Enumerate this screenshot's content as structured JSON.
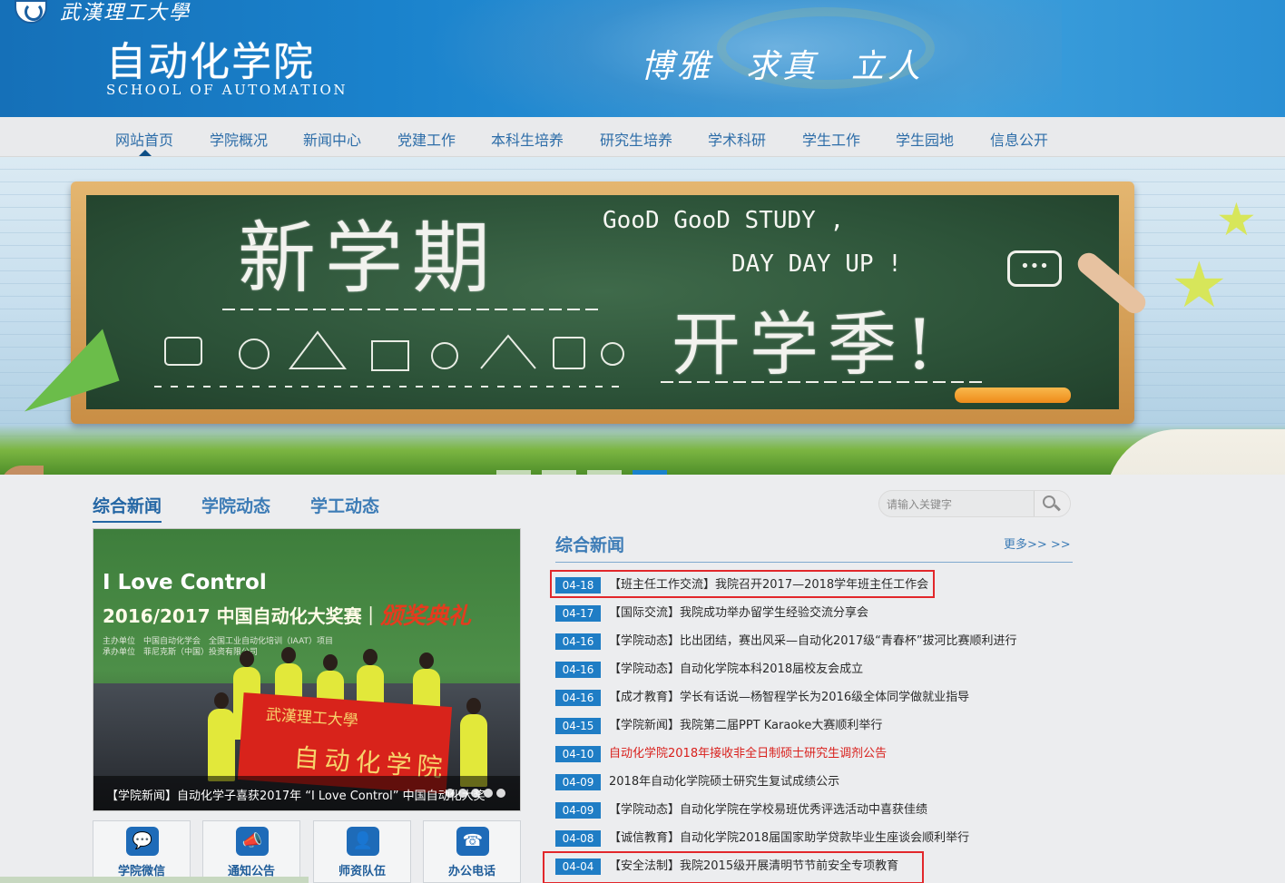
{
  "header": {
    "university": "武漢理工大學",
    "school_cn": "自动化学院",
    "school_en": "SCHOOL OF AUTOMATION",
    "motto": [
      "博雅",
      "求真",
      "立人"
    ]
  },
  "nav": {
    "items": [
      "网站首页",
      "学院概况",
      "新闻中心",
      "党建工作",
      "本科生培养",
      "研究生培养",
      "学术科研",
      "学生工作",
      "学生园地",
      "信息公开"
    ],
    "active": "网站首页"
  },
  "banner": {
    "line1": "新学期",
    "line2": "GooD GooD STUDY ,",
    "line3": "DAY DAY UP !",
    "line4": "开学季!",
    "bubble": "•••",
    "active_slide": 4,
    "slide_count": 4
  },
  "tabs": [
    "综合新闻",
    "学院动态",
    "学工动态"
  ],
  "search": {
    "placeholder": "请输入关键字"
  },
  "photo": {
    "title1": "I Love Control",
    "title2": "2016/2017 中国自动化大奖赛｜",
    "title3": "颁奖典礼",
    "meta1": "主办单位　中国自动化学会　全国工业自动化培训（IAAT）项目",
    "meta2": "承办单位　菲尼克斯（中国）投资有限公司",
    "flag_top": "武漢理工大學",
    "flag_main": "自动化学院",
    "caption": "【学院新闻】自动化学子喜获2017年 “I Love Control” 中国自动化大奖"
  },
  "quick_links": [
    {
      "label": "学院微信",
      "icon": "wechat-icon",
      "glyph": "💬"
    },
    {
      "label": "通知公告",
      "icon": "notice-icon",
      "glyph": "📣"
    },
    {
      "label": "师资队伍",
      "icon": "faculty-icon",
      "glyph": "👤"
    },
    {
      "label": "办公电话",
      "icon": "phone-icon",
      "glyph": "☎"
    }
  ],
  "news": {
    "heading": "综合新闻",
    "more": "更多>> >>",
    "items": [
      {
        "date": "04-18",
        "title": "【班主任工作交流】我院召开2017—2018学年班主任工作会",
        "highlight": true
      },
      {
        "date": "04-17",
        "title": "【国际交流】我院成功举办留学生经验交流分享会"
      },
      {
        "date": "04-16",
        "title": "【学院动态】比出团结，赛出风采—自动化2017级“青春杯”拔河比赛顺利进行"
      },
      {
        "date": "04-16",
        "title": "【学院动态】自动化学院本科2018届校友会成立"
      },
      {
        "date": "04-16",
        "title": "【成才教育】学长有话说—杨智程学长为2016级全体同学做就业指导"
      },
      {
        "date": "04-15",
        "title": "【学院新闻】我院第二届PPT Karaoke大赛顺利举行"
      },
      {
        "date": "04-10",
        "title": "自动化学院2018年接收非全日制硕士研究生调剂公告",
        "red": true
      },
      {
        "date": "04-09",
        "title": "2018年自动化学院硕士研究生复试成绩公示"
      },
      {
        "date": "04-09",
        "title": "【学院动态】自动化学院在学校易班优秀评选活动中喜获佳绩"
      },
      {
        "date": "04-08",
        "title": "【诚信教育】自动化学院2018届国家助学贷款毕业生座谈会顺利举行"
      },
      {
        "date": "04-04",
        "title": "【安全法制】我院2015级开展清明节节前安全专项教育",
        "highlight": true
      }
    ]
  },
  "colors": {
    "header_blue": "#1a82cc",
    "nav_text": "#2d6da8",
    "date_badge": "#1f7dc5",
    "alert_red": "#d9201c",
    "highlight_box": "#e2272b"
  }
}
